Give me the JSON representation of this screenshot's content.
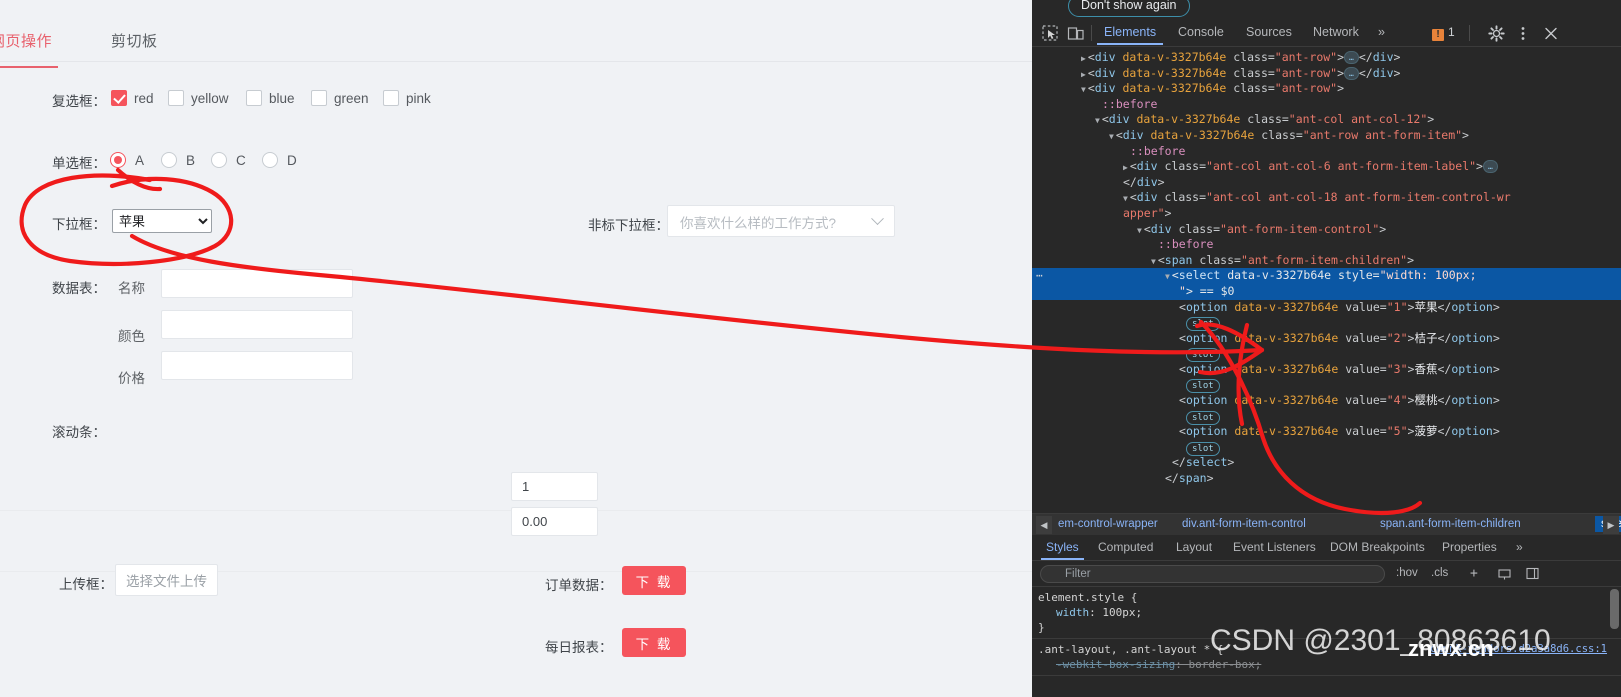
{
  "page": {
    "tabs": [
      {
        "label": "网页操作",
        "active": true
      },
      {
        "label": "剪切板",
        "active": false
      }
    ],
    "accent_color": "#f5545c",
    "background": "#f0f2f5",
    "checkbox_row": {
      "label": "复选框：",
      "items": [
        {
          "label": "red",
          "checked": true
        },
        {
          "label": "yellow",
          "checked": false
        },
        {
          "label": "blue",
          "checked": false
        },
        {
          "label": "green",
          "checked": false
        },
        {
          "label": "pink",
          "checked": false
        }
      ]
    },
    "radio_row": {
      "label": "单选框：",
      "items": [
        {
          "label": "A",
          "checked": true
        },
        {
          "label": "B",
          "checked": false
        },
        {
          "label": "C",
          "checked": false
        },
        {
          "label": "D",
          "checked": false
        }
      ]
    },
    "select_row": {
      "label": "下拉框：",
      "value": "苹果",
      "options": [
        "苹果",
        "桔子",
        "香蕉",
        "樱桃",
        "菠萝"
      ]
    },
    "custom_select_row": {
      "label": "非标下拉框：",
      "placeholder": "你喜欢什么样的工作方式?"
    },
    "table_form": {
      "label": "数据表：",
      "fields": [
        {
          "label": "名称",
          "value": ""
        },
        {
          "label": "颜色",
          "value": ""
        },
        {
          "label": "价格",
          "value": ""
        }
      ]
    },
    "scrollbar_row": {
      "label": "滚动条："
    },
    "number_inputs": [
      {
        "value": "1"
      },
      {
        "value": "0.00"
      }
    ],
    "upload_row": {
      "label": "上传框：",
      "button_label": "选择文件上传"
    },
    "download_rows": [
      {
        "label": "订单数据：",
        "button_label": "下 载"
      },
      {
        "label": "每日报表：",
        "button_label": "下 载"
      }
    ]
  },
  "devtools": {
    "dont_show_again": "Don't show again",
    "toolbar_icons": [
      "inspect-element-icon",
      "device-toolbar-icon"
    ],
    "tabs": [
      {
        "label": "Elements",
        "active": true
      },
      {
        "label": "Console",
        "active": false
      },
      {
        "label": "Sources",
        "active": false
      },
      {
        "label": "Network",
        "active": false
      },
      {
        "label": "»",
        "active": false
      }
    ],
    "error_count": "1",
    "right_icons": [
      "settings-gear-icon",
      "more-vertical-icon",
      "close-icon"
    ],
    "dom_lines": [
      {
        "indent": 7,
        "tri": "▶",
        "parts": [
          {
            "t": "pun",
            "v": "<"
          },
          {
            "t": "tag",
            "v": "div"
          },
          {
            "t": "attr",
            "v": " data-v-3327b64e"
          },
          {
            "t": "pun",
            "v": " class="
          },
          {
            "t": "val",
            "v": "\"ant-row\""
          },
          {
            "t": "pun",
            "v": ">"
          },
          {
            "t": "ellip",
            "v": "…"
          },
          {
            "t": "pun",
            "v": "</"
          },
          {
            "t": "tag",
            "v": "div"
          },
          {
            "t": "pun",
            "v": ">"
          }
        ]
      },
      {
        "indent": 7,
        "tri": "▶",
        "parts": [
          {
            "t": "pun",
            "v": "<"
          },
          {
            "t": "tag",
            "v": "div"
          },
          {
            "t": "attr",
            "v": " data-v-3327b64e"
          },
          {
            "t": "pun",
            "v": " class="
          },
          {
            "t": "val",
            "v": "\"ant-row\""
          },
          {
            "t": "pun",
            "v": ">"
          },
          {
            "t": "ellip",
            "v": "…"
          },
          {
            "t": "pun",
            "v": "</"
          },
          {
            "t": "tag",
            "v": "div"
          },
          {
            "t": "pun",
            "v": ">"
          }
        ]
      },
      {
        "indent": 7,
        "tri": "▼",
        "parts": [
          {
            "t": "pun",
            "v": "<"
          },
          {
            "t": "tag",
            "v": "div"
          },
          {
            "t": "attr",
            "v": " data-v-3327b64e"
          },
          {
            "t": "pun",
            "v": " class="
          },
          {
            "t": "val",
            "v": "\"ant-row\""
          },
          {
            "t": "pun",
            "v": ">"
          }
        ]
      },
      {
        "indent": 10,
        "tri": "",
        "parts": [
          {
            "t": "pseudo",
            "v": "::before"
          }
        ]
      },
      {
        "indent": 9,
        "tri": "▼",
        "parts": [
          {
            "t": "pun",
            "v": "<"
          },
          {
            "t": "tag",
            "v": "div"
          },
          {
            "t": "attr",
            "v": " data-v-3327b64e"
          },
          {
            "t": "pun",
            "v": " class="
          },
          {
            "t": "val",
            "v": "\"ant-col ant-col-12\""
          },
          {
            "t": "pun",
            "v": ">"
          }
        ]
      },
      {
        "indent": 11,
        "tri": "▼",
        "parts": [
          {
            "t": "pun",
            "v": "<"
          },
          {
            "t": "tag",
            "v": "div"
          },
          {
            "t": "attr",
            "v": " data-v-3327b64e"
          },
          {
            "t": "pun",
            "v": " class="
          },
          {
            "t": "val",
            "v": "\"ant-row ant-form-item\""
          },
          {
            "t": "pun",
            "v": ">"
          }
        ]
      },
      {
        "indent": 14,
        "tri": "",
        "parts": [
          {
            "t": "pseudo",
            "v": "::before"
          }
        ]
      },
      {
        "indent": 13,
        "tri": "▶",
        "parts": [
          {
            "t": "pun",
            "v": "<"
          },
          {
            "t": "tag",
            "v": "div"
          },
          {
            "t": "pun",
            "v": " class="
          },
          {
            "t": "val",
            "v": "\"ant-col ant-col-6 ant-form-item-label\""
          },
          {
            "t": "pun",
            "v": ">"
          },
          {
            "t": "ellip",
            "v": "…"
          }
        ]
      },
      {
        "indent": 13,
        "tri": "",
        "parts": [
          {
            "t": "pun",
            "v": "</"
          },
          {
            "t": "tag",
            "v": "div"
          },
          {
            "t": "pun",
            "v": ">"
          }
        ]
      },
      {
        "indent": 13,
        "tri": "▼",
        "parts": [
          {
            "t": "pun",
            "v": "<"
          },
          {
            "t": "tag",
            "v": "div"
          },
          {
            "t": "pun",
            "v": " class="
          },
          {
            "t": "val",
            "v": "\"ant-col ant-col-18 ant-form-item-control-wr"
          }
        ]
      },
      {
        "indent": 13,
        "tri": "",
        "parts": [
          {
            "t": "val",
            "v": "apper\""
          },
          {
            "t": "pun",
            "v": ">"
          }
        ]
      },
      {
        "indent": 15,
        "tri": "▼",
        "parts": [
          {
            "t": "pun",
            "v": "<"
          },
          {
            "t": "tag",
            "v": "div"
          },
          {
            "t": "pun",
            "v": " class="
          },
          {
            "t": "val",
            "v": "\"ant-form-item-control\""
          },
          {
            "t": "pun",
            "v": ">"
          }
        ]
      },
      {
        "indent": 18,
        "tri": "",
        "parts": [
          {
            "t": "pseudo",
            "v": "::before"
          }
        ]
      },
      {
        "indent": 17,
        "tri": "▼",
        "parts": [
          {
            "t": "pun",
            "v": "<"
          },
          {
            "t": "tag",
            "v": "span"
          },
          {
            "t": "pun",
            "v": " class="
          },
          {
            "t": "val",
            "v": "\"ant-form-item-children\""
          },
          {
            "t": "pun",
            "v": ">"
          }
        ]
      },
      {
        "indent": 19,
        "tri": "▼",
        "selected": true,
        "parts": [
          {
            "t": "pun",
            "v": "<"
          },
          {
            "t": "tag",
            "v": "select"
          },
          {
            "t": "attr",
            "v": " data-v-3327b64e"
          },
          {
            "t": "pun",
            "v": " style="
          },
          {
            "t": "val",
            "v": "\"width: 100px;"
          }
        ]
      },
      {
        "indent": 21,
        "tri": "",
        "selected": true,
        "parts": [
          {
            "t": "val",
            "v": "\""
          },
          {
            "t": "pun",
            "v": "> == "
          },
          {
            "t": "pun",
            "v": "$0"
          }
        ]
      },
      {
        "indent": 21,
        "tri": "",
        "parts": [
          {
            "t": "pun",
            "v": "<"
          },
          {
            "t": "tag",
            "v": "option"
          },
          {
            "t": "attr",
            "v": " data-v-3327b64e"
          },
          {
            "t": "pun",
            "v": " value="
          },
          {
            "t": "val",
            "v": "\"1\""
          },
          {
            "t": "pun",
            "v": ">"
          },
          {
            "t": "txt",
            "v": "苹果"
          },
          {
            "t": "pun",
            "v": "</"
          },
          {
            "t": "tag",
            "v": "option"
          },
          {
            "t": "pun",
            "v": ">"
          }
        ]
      },
      {
        "indent": 22,
        "tri": "",
        "parts": [
          {
            "t": "slot",
            "v": "slot"
          }
        ]
      },
      {
        "indent": 21,
        "tri": "",
        "parts": [
          {
            "t": "pun",
            "v": "<"
          },
          {
            "t": "tag",
            "v": "option"
          },
          {
            "t": "attr",
            "v": " data-v-3327b64e"
          },
          {
            "t": "pun",
            "v": " value="
          },
          {
            "t": "val",
            "v": "\"2\""
          },
          {
            "t": "pun",
            "v": ">"
          },
          {
            "t": "txt",
            "v": "桔子"
          },
          {
            "t": "pun",
            "v": "</"
          },
          {
            "t": "tag",
            "v": "option"
          },
          {
            "t": "pun",
            "v": ">"
          }
        ]
      },
      {
        "indent": 22,
        "tri": "",
        "parts": [
          {
            "t": "slot",
            "v": "slot"
          }
        ]
      },
      {
        "indent": 21,
        "tri": "",
        "parts": [
          {
            "t": "pun",
            "v": "<"
          },
          {
            "t": "tag",
            "v": "option"
          },
          {
            "t": "attr",
            "v": " data-v-3327b64e"
          },
          {
            "t": "pun",
            "v": " value="
          },
          {
            "t": "val",
            "v": "\"3\""
          },
          {
            "t": "pun",
            "v": ">"
          },
          {
            "t": "txt",
            "v": "香蕉"
          },
          {
            "t": "pun",
            "v": "</"
          },
          {
            "t": "tag",
            "v": "option"
          },
          {
            "t": "pun",
            "v": ">"
          }
        ]
      },
      {
        "indent": 22,
        "tri": "",
        "parts": [
          {
            "t": "slot",
            "v": "slot"
          }
        ]
      },
      {
        "indent": 21,
        "tri": "",
        "parts": [
          {
            "t": "pun",
            "v": "<"
          },
          {
            "t": "tag",
            "v": "option"
          },
          {
            "t": "attr",
            "v": " data-v-3327b64e"
          },
          {
            "t": "pun",
            "v": " value="
          },
          {
            "t": "val",
            "v": "\"4\""
          },
          {
            "t": "pun",
            "v": ">"
          },
          {
            "t": "txt",
            "v": "樱桃"
          },
          {
            "t": "pun",
            "v": "</"
          },
          {
            "t": "tag",
            "v": "option"
          },
          {
            "t": "pun",
            "v": ">"
          }
        ]
      },
      {
        "indent": 22,
        "tri": "",
        "parts": [
          {
            "t": "slot",
            "v": "slot"
          }
        ]
      },
      {
        "indent": 21,
        "tri": "",
        "parts": [
          {
            "t": "pun",
            "v": "<"
          },
          {
            "t": "tag",
            "v": "option"
          },
          {
            "t": "attr",
            "v": " data-v-3327b64e"
          },
          {
            "t": "pun",
            "v": " value="
          },
          {
            "t": "val",
            "v": "\"5\""
          },
          {
            "t": "pun",
            "v": ">"
          },
          {
            "t": "txt",
            "v": "菠萝"
          },
          {
            "t": "pun",
            "v": "</"
          },
          {
            "t": "tag",
            "v": "option"
          },
          {
            "t": "pun",
            "v": ">"
          }
        ]
      },
      {
        "indent": 22,
        "tri": "",
        "parts": [
          {
            "t": "slot",
            "v": "slot"
          }
        ]
      },
      {
        "indent": 20,
        "tri": "",
        "parts": [
          {
            "t": "pun",
            "v": "</"
          },
          {
            "t": "tag",
            "v": "select"
          },
          {
            "t": "pun",
            "v": ">"
          }
        ]
      },
      {
        "indent": 19,
        "tri": "",
        "parts": [
          {
            "t": "pun",
            "v": "</"
          },
          {
            "t": "tag",
            "v": "span"
          },
          {
            "t": "pun",
            "v": ">"
          }
        ]
      }
    ],
    "breadcrumb": [
      {
        "label": "em-control-wrapper",
        "selected": false
      },
      {
        "label": "div.ant-form-item-control",
        "selected": false
      },
      {
        "label": "span.ant-form-item-children",
        "selected": false
      },
      {
        "label": "select",
        "selected": true
      }
    ],
    "styles_tabs": [
      {
        "label": "Styles",
        "active": true
      },
      {
        "label": "Computed",
        "active": false
      },
      {
        "label": "Layout",
        "active": false
      },
      {
        "label": "Event Listeners",
        "active": false
      },
      {
        "label": "DOM Breakpoints",
        "active": false
      },
      {
        "label": "Properties",
        "active": false
      },
      {
        "label": "»",
        "active": false
      }
    ],
    "filter_placeholder": "Filter",
    "filter_actions": [
      ":hov",
      ".cls"
    ],
    "filter_icons": [
      "add-style-rule-icon",
      "element-state-icon",
      "toggle-sidebar-icon"
    ],
    "css_rules": [
      {
        "selector": "element.style {",
        "close": "}",
        "source": "",
        "declarations": [
          {
            "prop": "width",
            "value": "100px;",
            "struck": false
          }
        ]
      },
      {
        "selector": ".ant-layout, .ant-layout * {",
        "close": "",
        "source": "chunk-vendors.d2a3a8d6.css:1",
        "declarations": [
          {
            "prop": "-webkit-box-sizing",
            "value": "border-box;",
            "struck": true
          }
        ]
      }
    ]
  },
  "watermark": {
    "main": "CSDN @2301_80863610",
    "secondary": "znwx.cn"
  }
}
